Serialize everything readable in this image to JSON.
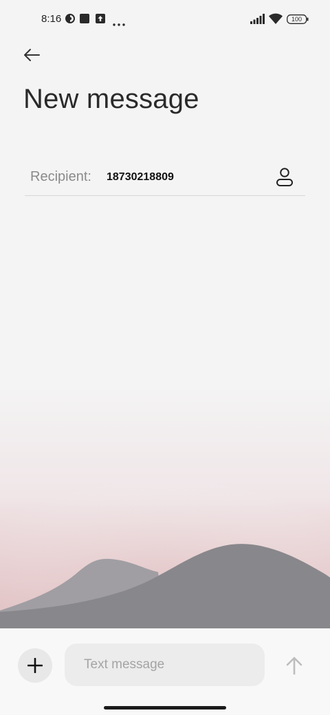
{
  "status_bar": {
    "time": "8:16",
    "battery": "100",
    "icons": [
      "status-app-icon",
      "square-icon",
      "upload-icon",
      "more-icon",
      "signal-icon",
      "wifi-icon",
      "battery-icon"
    ]
  },
  "header": {
    "back_icon": "arrow-left-icon",
    "title": "New message"
  },
  "recipient": {
    "label": "Recipient:",
    "value": "18730218809",
    "contact_icon": "person-icon"
  },
  "composer": {
    "attach_icon": "plus-icon",
    "placeholder": "Text message",
    "value": "",
    "send_icon": "arrow-up-icon"
  },
  "colors": {
    "background": "#f4f4f4",
    "hills": "#88878c",
    "hills_back": "#a19fa4",
    "sky_tint": "#e6c9cb"
  }
}
